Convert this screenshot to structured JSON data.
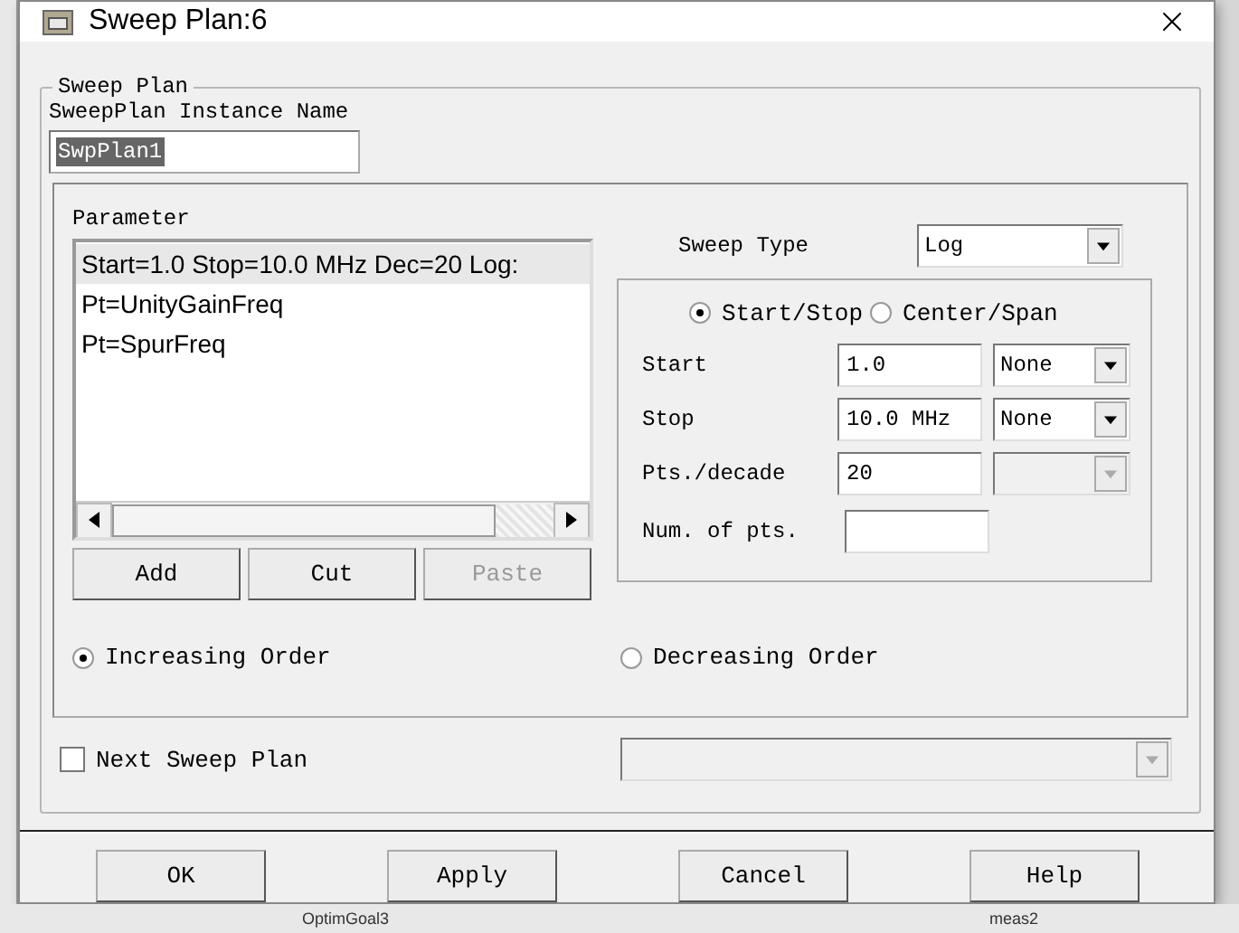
{
  "window": {
    "title": "Sweep Plan:6"
  },
  "group_title": "Sweep Plan",
  "instance_name": {
    "label": "SweepPlan Instance Name",
    "value": "SwpPlan1",
    "selected": true
  },
  "parameter": {
    "label": "Parameter",
    "items": [
      {
        "text": "Start=1.0 Stop=10.0 MHz Dec=20 Log:",
        "selected": true
      },
      {
        "text": "Pt=UnityGainFreq",
        "selected": false
      },
      {
        "text": "Pt=SpurFreq",
        "selected": false
      }
    ],
    "buttons": [
      {
        "label": "Add",
        "disabled": false
      },
      {
        "label": "Cut",
        "disabled": false
      },
      {
        "label": "Paste",
        "disabled": true
      }
    ]
  },
  "sweep_type": {
    "label": "Sweep Type",
    "value": "Log"
  },
  "range_mode": [
    {
      "label": "Start/Stop",
      "selected": true
    },
    {
      "label": "Center/Span",
      "selected": false
    }
  ],
  "fields": [
    {
      "kind": "unit",
      "label": "Start",
      "value": "1.0",
      "unit": "None",
      "unit_disabled": false
    },
    {
      "kind": "unit",
      "label": "Stop",
      "value": "10.0 MHz",
      "unit": "None",
      "unit_disabled": false
    },
    {
      "kind": "unit",
      "label": "Pts./decade",
      "value": "20",
      "unit_disabled": true
    },
    {
      "kind": "plain",
      "label": "Num. of pts."
    }
  ],
  "order": [
    {
      "label": "Increasing Order",
      "selected": true
    },
    {
      "label": "Decreasing Order",
      "selected": false
    }
  ],
  "next_sweep_plan": {
    "label": "Next Sweep Plan",
    "checked": false,
    "dropdown_disabled": true
  },
  "buttons": [
    "OK",
    "Apply",
    "Cancel",
    "Help"
  ],
  "background": {
    "labels": [
      "OptimGoal3",
      "meas2"
    ]
  }
}
